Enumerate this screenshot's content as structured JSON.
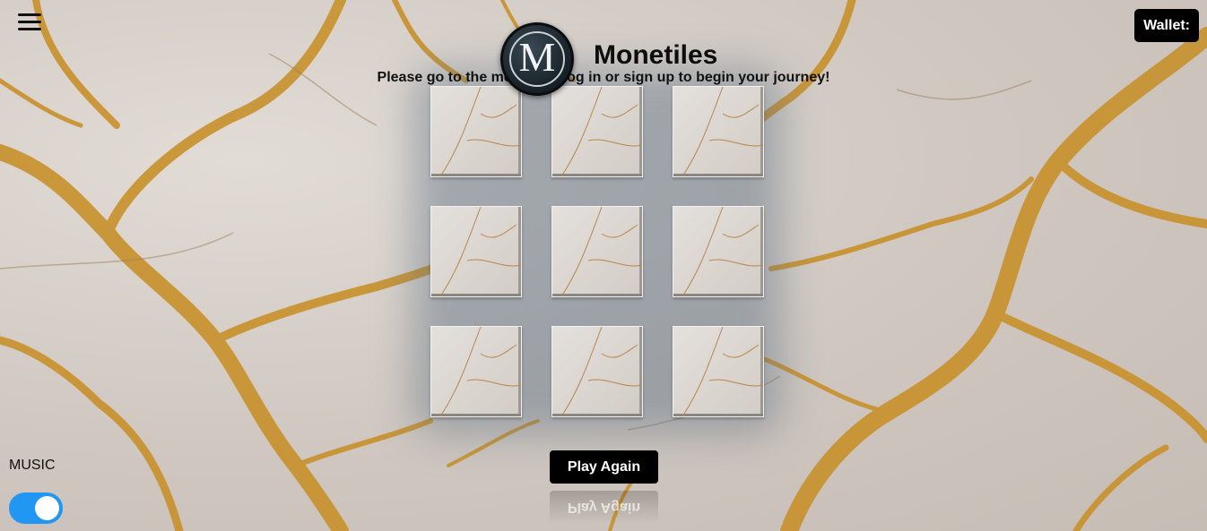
{
  "app": {
    "title": "Monetiles",
    "logo_letter": "M",
    "subtitle": "Please go to the menu and log in or sign up to begin your journey!"
  },
  "header": {
    "menu_icon": "hamburger-menu-icon",
    "wallet_label": "Wallet:"
  },
  "board": {
    "rows": 3,
    "columns": 3,
    "tiles": [
      {
        "id": "tile-1"
      },
      {
        "id": "tile-2"
      },
      {
        "id": "tile-3"
      },
      {
        "id": "tile-4"
      },
      {
        "id": "tile-5"
      },
      {
        "id": "tile-6"
      },
      {
        "id": "tile-7"
      },
      {
        "id": "tile-8"
      },
      {
        "id": "tile-9"
      }
    ]
  },
  "controls": {
    "play_again_label": "Play Again",
    "music_label": "MUSIC",
    "music_on": true
  },
  "colors": {
    "accent_toggle": "#2196f3",
    "button_bg": "#000000",
    "marble_vein": "#c8912b"
  }
}
